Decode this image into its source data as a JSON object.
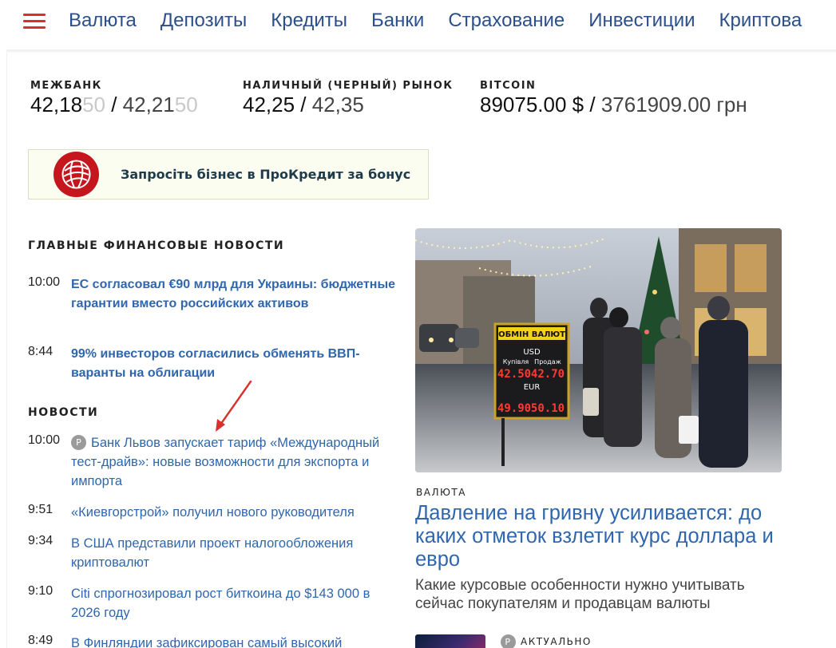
{
  "nav": {
    "items": [
      "Валюта",
      "Депозиты",
      "Кредиты",
      "Банки",
      "Страхование",
      "Инвестиции",
      "Криптова"
    ]
  },
  "rates": {
    "mezhbank": {
      "label": "МЕЖБАНК",
      "buy_main": "42,18",
      "buy_dim": "50",
      "sell_main": "42,21",
      "sell_dim": "50"
    },
    "cash": {
      "label": "НАЛИЧНЫЙ (ЧЕРНЫЙ) РЫНОК",
      "buy": "42,25",
      "sell": "42,35"
    },
    "bitcoin": {
      "label": "BITCOIN",
      "usd": "89075.00 $",
      "uah": "3761909.00 грн"
    }
  },
  "banner": {
    "text": "Запросіть бізнес в ПроКредит за бонус"
  },
  "main_news": {
    "title": "ГЛАВНЫЕ ФИНАНСОВЫЕ НОВОСТИ",
    "items": [
      {
        "time": "10:00",
        "title": "ЕС согласовал €90 млрд для Украины: бюджетные гарантии вместо российских активов"
      },
      {
        "time": "8:44",
        "title": "99% инвесторов согласились обменять ВВП-варанты на облигации"
      }
    ]
  },
  "news": {
    "title": "НОВОСТИ",
    "items": [
      {
        "time": "10:00",
        "badge": "P",
        "title": "Банк Львов запускает тариф «Международный тест-драйв»: новые возможности для экспорта и импорта"
      },
      {
        "time": "9:51",
        "title": "«Киевгорстрой» получил нового руководителя"
      },
      {
        "time": "9:34",
        "title": "В США представили проект налогообложения криптовалют"
      },
      {
        "time": "9:10",
        "title": "Citi спрогнозировал рост биткоина до $143 000 в 2026 году"
      },
      {
        "time": "8:49",
        "title": "В Финляндии зафиксирован самый высокий"
      }
    ]
  },
  "feature": {
    "category": "ВАЛЮТА",
    "title": "Давление на гривну усиливается: до каких отметок взлетит курс доллара и евро",
    "subtitle": "Какие курсовые особенности нужно учитывать сейчас покупателям и продавцам валюты",
    "sign": {
      "header": "ОБМІН ВАЛЮТ",
      "usd": "USD",
      "eur": "EUR",
      "buy_label": "Купівля",
      "sell_label": "Продаж",
      "usd_buy": "42.50",
      "usd_sell": "42.70",
      "eur_buy": "49.90",
      "eur_sell": "50.10"
    }
  },
  "second": {
    "badge": "P",
    "category": "АКТУАЛЬНО"
  },
  "colors": {
    "accent_red": "#d9302b",
    "link_blue": "#2f66ad",
    "nav_blue": "#2b4f8a"
  }
}
